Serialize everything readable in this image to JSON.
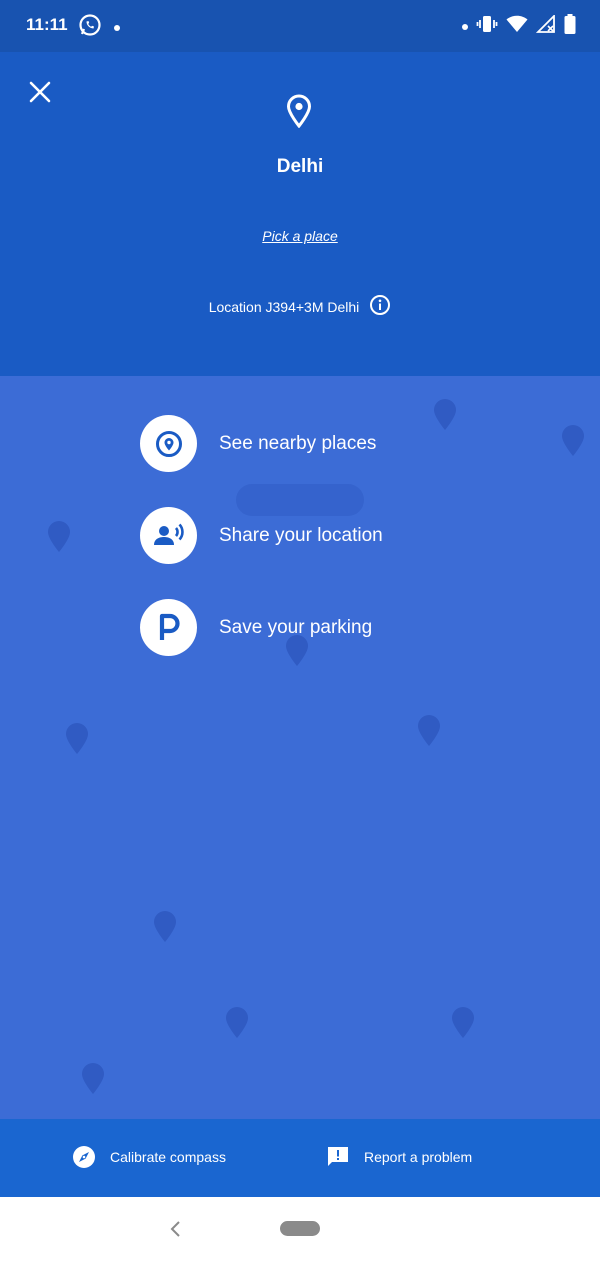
{
  "status_bar": {
    "time": "11:11",
    "icons": [
      "whatsapp-icon",
      "notification-dot-icon",
      "vibrate-icon",
      "wifi-icon",
      "no-signal-icon",
      "battery-icon"
    ]
  },
  "header": {
    "place_name": "Delhi",
    "pick_link": "Pick a place",
    "plus_code": "Location J394+3M Delhi"
  },
  "actions": [
    {
      "label": "See nearby places",
      "icon": "nearby-places-icon"
    },
    {
      "label": "Share your location",
      "icon": "share-location-icon"
    },
    {
      "label": "Save your parking",
      "icon": "parking-icon"
    }
  ],
  "bottom_bar": {
    "calibrate": "Calibrate compass",
    "report": "Report a problem"
  },
  "colors": {
    "header_bg": "#1a5bc4",
    "overlay_bg": "#3c6cd6",
    "bottom_bg": "#1a66d0",
    "icon_blue": "#1a5bc4"
  }
}
